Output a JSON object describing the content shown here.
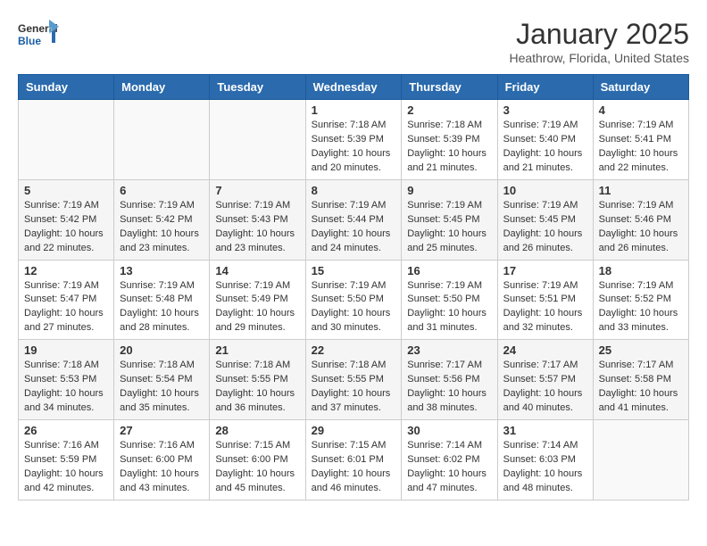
{
  "header": {
    "logo_line1": "General",
    "logo_line2": "Blue",
    "month_title": "January 2025",
    "location": "Heathrow, Florida, United States"
  },
  "weekdays": [
    "Sunday",
    "Monday",
    "Tuesday",
    "Wednesday",
    "Thursday",
    "Friday",
    "Saturday"
  ],
  "weeks": [
    [
      {
        "day": "",
        "info": ""
      },
      {
        "day": "",
        "info": ""
      },
      {
        "day": "",
        "info": ""
      },
      {
        "day": "1",
        "info": "Sunrise: 7:18 AM\nSunset: 5:39 PM\nDaylight: 10 hours\nand 20 minutes."
      },
      {
        "day": "2",
        "info": "Sunrise: 7:18 AM\nSunset: 5:39 PM\nDaylight: 10 hours\nand 21 minutes."
      },
      {
        "day": "3",
        "info": "Sunrise: 7:19 AM\nSunset: 5:40 PM\nDaylight: 10 hours\nand 21 minutes."
      },
      {
        "day": "4",
        "info": "Sunrise: 7:19 AM\nSunset: 5:41 PM\nDaylight: 10 hours\nand 22 minutes."
      }
    ],
    [
      {
        "day": "5",
        "info": "Sunrise: 7:19 AM\nSunset: 5:42 PM\nDaylight: 10 hours\nand 22 minutes."
      },
      {
        "day": "6",
        "info": "Sunrise: 7:19 AM\nSunset: 5:42 PM\nDaylight: 10 hours\nand 23 minutes."
      },
      {
        "day": "7",
        "info": "Sunrise: 7:19 AM\nSunset: 5:43 PM\nDaylight: 10 hours\nand 23 minutes."
      },
      {
        "day": "8",
        "info": "Sunrise: 7:19 AM\nSunset: 5:44 PM\nDaylight: 10 hours\nand 24 minutes."
      },
      {
        "day": "9",
        "info": "Sunrise: 7:19 AM\nSunset: 5:45 PM\nDaylight: 10 hours\nand 25 minutes."
      },
      {
        "day": "10",
        "info": "Sunrise: 7:19 AM\nSunset: 5:45 PM\nDaylight: 10 hours\nand 26 minutes."
      },
      {
        "day": "11",
        "info": "Sunrise: 7:19 AM\nSunset: 5:46 PM\nDaylight: 10 hours\nand 26 minutes."
      }
    ],
    [
      {
        "day": "12",
        "info": "Sunrise: 7:19 AM\nSunset: 5:47 PM\nDaylight: 10 hours\nand 27 minutes."
      },
      {
        "day": "13",
        "info": "Sunrise: 7:19 AM\nSunset: 5:48 PM\nDaylight: 10 hours\nand 28 minutes."
      },
      {
        "day": "14",
        "info": "Sunrise: 7:19 AM\nSunset: 5:49 PM\nDaylight: 10 hours\nand 29 minutes."
      },
      {
        "day": "15",
        "info": "Sunrise: 7:19 AM\nSunset: 5:50 PM\nDaylight: 10 hours\nand 30 minutes."
      },
      {
        "day": "16",
        "info": "Sunrise: 7:19 AM\nSunset: 5:50 PM\nDaylight: 10 hours\nand 31 minutes."
      },
      {
        "day": "17",
        "info": "Sunrise: 7:19 AM\nSunset: 5:51 PM\nDaylight: 10 hours\nand 32 minutes."
      },
      {
        "day": "18",
        "info": "Sunrise: 7:19 AM\nSunset: 5:52 PM\nDaylight: 10 hours\nand 33 minutes."
      }
    ],
    [
      {
        "day": "19",
        "info": "Sunrise: 7:18 AM\nSunset: 5:53 PM\nDaylight: 10 hours\nand 34 minutes."
      },
      {
        "day": "20",
        "info": "Sunrise: 7:18 AM\nSunset: 5:54 PM\nDaylight: 10 hours\nand 35 minutes."
      },
      {
        "day": "21",
        "info": "Sunrise: 7:18 AM\nSunset: 5:55 PM\nDaylight: 10 hours\nand 36 minutes."
      },
      {
        "day": "22",
        "info": "Sunrise: 7:18 AM\nSunset: 5:55 PM\nDaylight: 10 hours\nand 37 minutes."
      },
      {
        "day": "23",
        "info": "Sunrise: 7:17 AM\nSunset: 5:56 PM\nDaylight: 10 hours\nand 38 minutes."
      },
      {
        "day": "24",
        "info": "Sunrise: 7:17 AM\nSunset: 5:57 PM\nDaylight: 10 hours\nand 40 minutes."
      },
      {
        "day": "25",
        "info": "Sunrise: 7:17 AM\nSunset: 5:58 PM\nDaylight: 10 hours\nand 41 minutes."
      }
    ],
    [
      {
        "day": "26",
        "info": "Sunrise: 7:16 AM\nSunset: 5:59 PM\nDaylight: 10 hours\nand 42 minutes."
      },
      {
        "day": "27",
        "info": "Sunrise: 7:16 AM\nSunset: 6:00 PM\nDaylight: 10 hours\nand 43 minutes."
      },
      {
        "day": "28",
        "info": "Sunrise: 7:15 AM\nSunset: 6:00 PM\nDaylight: 10 hours\nand 45 minutes."
      },
      {
        "day": "29",
        "info": "Sunrise: 7:15 AM\nSunset: 6:01 PM\nDaylight: 10 hours\nand 46 minutes."
      },
      {
        "day": "30",
        "info": "Sunrise: 7:14 AM\nSunset: 6:02 PM\nDaylight: 10 hours\nand 47 minutes."
      },
      {
        "day": "31",
        "info": "Sunrise: 7:14 AM\nSunset: 6:03 PM\nDaylight: 10 hours\nand 48 minutes."
      },
      {
        "day": "",
        "info": ""
      }
    ]
  ]
}
